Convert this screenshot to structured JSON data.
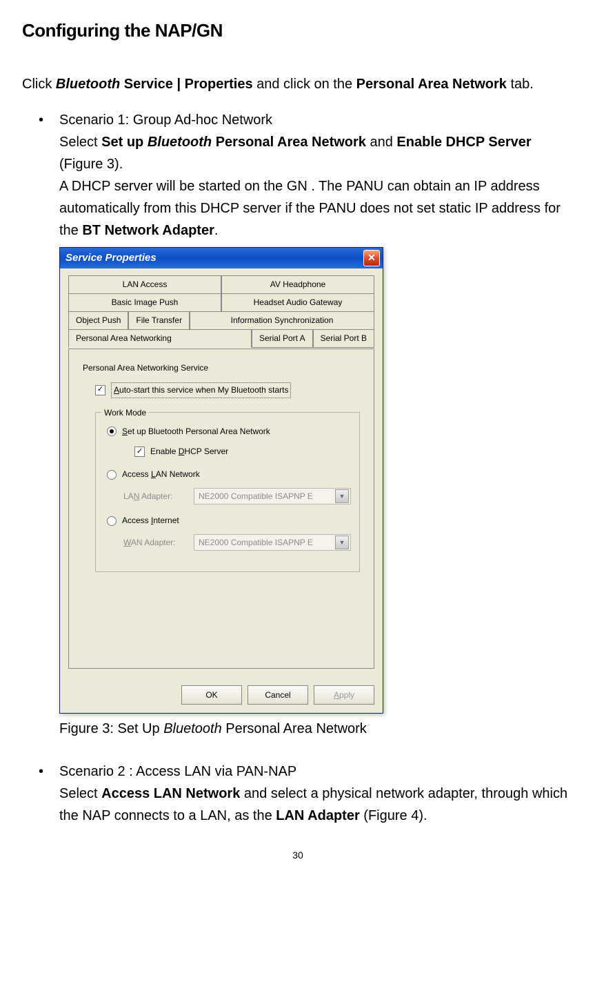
{
  "heading": "Configuring the NAP/GN",
  "intro": {
    "pre": "Click ",
    "bluetooth": "Bluetooth",
    "service_properties": " Service | Properties",
    "mid": " and click on the ",
    "pan": "Personal Area Network",
    "tail": " tab."
  },
  "scenario1": {
    "title": "Scenario 1: Group Ad-hoc Network",
    "line2_pre": "Select ",
    "line2_setup": "Set up ",
    "line2_bluetooth": "Bluetooth",
    "line2_pan": " Personal Area Network",
    "line2_and": " and ",
    "line2_dhcp": "Enable DHCP Server",
    "line2_fig": " (Figure 3).",
    "line3_a": "A DHCP server will be started on the GN .   The PANU   can obtain an IP address automatically from this DHCP server if the PANU does not set static IP address for the ",
    "line3_bold": "BT Network Adapter",
    "line3_tail": "."
  },
  "dialog": {
    "title": "Service Properties",
    "tabs_row1": [
      "LAN Access",
      "AV Headphone"
    ],
    "tabs_row2": [
      "Basic Image Push",
      "Headset Audio Gateway"
    ],
    "tabs_row3": [
      "Object Push",
      "File Transfer",
      "Information Synchronization"
    ],
    "tabs_row4": [
      "Personal Area Networking",
      "Serial Port A",
      "Serial Port B"
    ],
    "section_title": "Personal Area Networking Service",
    "autostart_pre": "A",
    "autostart_rest": "uto-start this service when My Bluetooth starts",
    "workmode": "Work Mode",
    "radio1_pre": "S",
    "radio1_rest": "et up Bluetooth Personal Area Network",
    "enable_dhcp_pre": "Enable ",
    "enable_dhcp_u": "D",
    "enable_dhcp_rest": "HCP Server",
    "radio2_pre": "Access ",
    "radio2_u": "L",
    "radio2_rest": "AN Network",
    "lan_label_pre": "LA",
    "lan_label_u": "N",
    "lan_label_rest": " Adapter:",
    "lan_value": "NE2000 Compatible ISAPNP E",
    "radio3_pre": "Access ",
    "radio3_u": "I",
    "radio3_rest": "nternet",
    "wan_label_u": "W",
    "wan_label_rest": "AN Adapter:",
    "wan_value": "NE2000 Compatible ISAPNP E",
    "ok": "OK",
    "cancel": "Cancel",
    "apply_u": "A",
    "apply_rest": "pply"
  },
  "caption_pre": "Figure 3: Set Up ",
  "caption_bluetooth": "Bluetooth",
  "caption_rest": " Personal Area Network",
  "scenario2": {
    "title": "Scenario 2 : Access LAN via PAN-NAP",
    "line_pre": "Select ",
    "line_bold1": "Access LAN Network",
    "line_mid": " and select a physical network adapter, through which the NAP connects to a LAN, as the ",
    "line_bold2": "LAN Adapter",
    "line_tail": " (Figure 4)."
  },
  "page_number": "30"
}
